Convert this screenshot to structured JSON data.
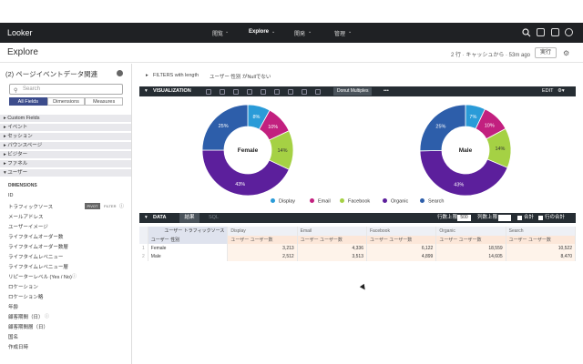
{
  "nav": {
    "logo": "Looker",
    "menus": [
      {
        "label": "閲覧"
      },
      {
        "label": "Explore"
      },
      {
        "label": "開発"
      },
      {
        "label": "管理"
      }
    ]
  },
  "header": {
    "title": "Explore",
    "status": "2 行 · キャッシュから · 53m ago",
    "run_label": "実行"
  },
  "sidebar": {
    "explore_title": "(2) ページイベントデータ関連",
    "search_placeholder": "Search",
    "tabs": [
      "All Fields",
      "Dimensions",
      "Measures"
    ],
    "groups": [
      "Custom Fields",
      "イベント",
      "セッション",
      "バウンスページ",
      "ビジター",
      "ファネル",
      "ユーザー"
    ],
    "section": "DIMENSIONS",
    "fields": [
      "ID",
      "トラフィックソース",
      "メールアドレス",
      "ユーザーイメージ",
      "ライフタイムオーダー数",
      "ライフタイムオーダー数層",
      "ライフタイムレベニュー",
      "ライフタイムレベニュー層",
      "リピーターレベル (Yes / No)",
      "ロケーション",
      "ロケーション略",
      "年齢",
      "顧客期間（日）",
      "顧客期間層（日）",
      "国名",
      "作成日時"
    ],
    "pivot_label": "PIVOT",
    "filter_label": "FILTER"
  },
  "filters": {
    "label": "FILTERS with length",
    "value": "ユーザー 性別 がNullでない"
  },
  "viz": {
    "label": "VISUALIZATION",
    "chip": "Donut Multiples",
    "more": "•••",
    "edit": "EDIT"
  },
  "data_section": {
    "label": "DATA",
    "tab_results": "結果",
    "tab_sql": "SQL",
    "row_limit_label": "行数上限",
    "row_limit_value": "500",
    "col_limit_label": "列数上限",
    "totals_label": "合計",
    "row_totals_label": "行の合計"
  },
  "colors": {
    "Display": "#2a9bd8",
    "Email": "#c2207f",
    "Facebook": "#a5d144",
    "Organic": "#5c1f9c",
    "Search": "#2d5eaa"
  },
  "chart_data": [
    {
      "type": "pie",
      "title": "Female",
      "categories": [
        "Display",
        "Email",
        "Facebook",
        "Organic",
        "Search"
      ],
      "values": [
        8,
        10,
        14,
        43,
        25
      ],
      "labels": [
        "8%",
        "10%",
        "14%",
        "43%",
        "25%"
      ]
    },
    {
      "type": "pie",
      "title": "Male",
      "categories": [
        "Display",
        "Email",
        "Facebook",
        "Organic",
        "Search"
      ],
      "values": [
        7,
        10,
        14,
        43,
        25
      ],
      "labels": [
        "7%",
        "10%",
        "14%",
        "43%",
        "25%"
      ]
    }
  ],
  "table": {
    "pivot_header": "ユーザー トラフィックソース",
    "dim_header": "ユーザー 性別",
    "pivot_cols": [
      "Display",
      "Email",
      "Facebook",
      "Organic",
      "Search"
    ],
    "measure_header": "ユーザー ユーザー数",
    "rows": [
      {
        "num": "1",
        "gender": "Female",
        "values": [
          "3,213",
          "4,336",
          "6,122",
          "18,559",
          "10,522"
        ]
      },
      {
        "num": "2",
        "gender": "Male",
        "values": [
          "2,512",
          "3,513",
          "4,899",
          "14,605",
          "8,470"
        ]
      }
    ]
  }
}
